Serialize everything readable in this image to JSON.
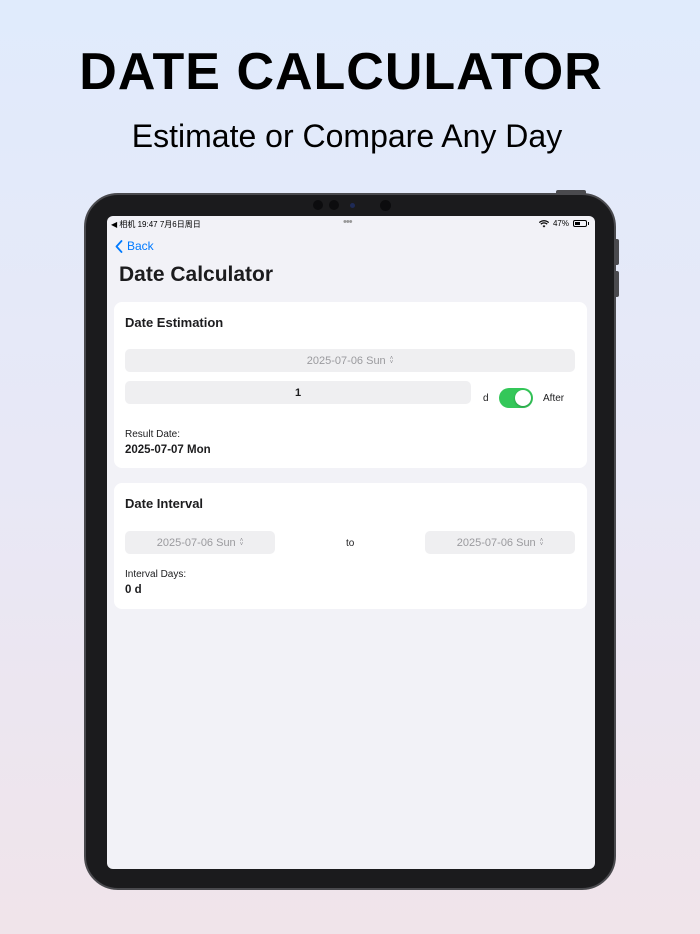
{
  "promo": {
    "headline": "DATE CALCULATOR",
    "subheadline": "Estimate or Compare Any Day"
  },
  "status_bar": {
    "left": "◀ 相机   19:47   7月6日周日",
    "dots": "•••",
    "battery": "47%"
  },
  "nav": {
    "back_label": "Back",
    "title": "Date Calculator"
  },
  "estimation": {
    "title": "Date Estimation",
    "start_date": "2025-07-06 Sun",
    "offset_value": "1",
    "unit": "d",
    "toggle_on": true,
    "direction_label": "After",
    "result_label": "Result Date:",
    "result_value": "2025-07-07 Mon"
  },
  "interval": {
    "title": "Date Interval",
    "from_date": "2025-07-06 Sun",
    "separator": "to",
    "to_date": "2025-07-06 Sun",
    "result_label": "Interval Days:",
    "result_value": "0 d"
  },
  "colors": {
    "accent": "#007aff",
    "toggle_on": "#34c759",
    "card_bg": "#ffffff",
    "screen_bg": "#f2f2f7"
  }
}
